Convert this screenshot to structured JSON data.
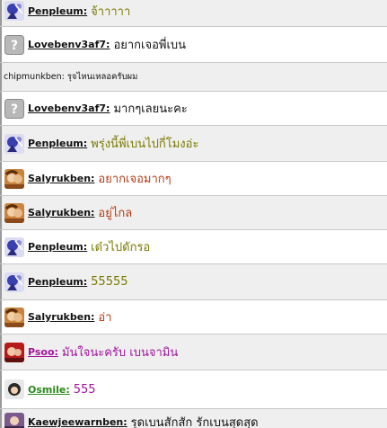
{
  "chat": {
    "messages": [
      {
        "kind": "user",
        "avatar": "penpleum-avatar",
        "name": "Penpleum:",
        "text": "จ้าาาาา",
        "name_color": "#111111",
        "text_color": "#7a7a00",
        "alt": true
      },
      {
        "kind": "user",
        "avatar": "guest-avatar",
        "name": "Lovebenv3af7:",
        "text": "อยากเจอพี่เบน",
        "name_color": "#111111",
        "text_color": "#111111",
        "alt": false
      },
      {
        "kind": "plain",
        "text": "chipmunkben: รุจไหนเหลอครับผม",
        "alt": true
      },
      {
        "kind": "user",
        "avatar": "guest-avatar",
        "name": "Lovebenv3af7:",
        "text": "มากๆเลยนะคะ",
        "name_color": "#111111",
        "text_color": "#111111",
        "alt": false
      },
      {
        "kind": "user",
        "avatar": "penpleum-avatar",
        "name": "Penpleum:",
        "text": "พรุ่งนี้พี่เบนไปกี่โมงอ่ะ",
        "name_color": "#111111",
        "text_color": "#7a7a00",
        "alt": true
      },
      {
        "kind": "user",
        "avatar": "salyrukben-avatar",
        "name": "Salyrukben:",
        "text": "อยากเจอมากๆ",
        "name_color": "#111111",
        "text_color": "#b43c14",
        "alt": false
      },
      {
        "kind": "user",
        "avatar": "salyrukben-avatar",
        "name": "Salyrukben:",
        "text": "อยู่ไกล",
        "name_color": "#111111",
        "text_color": "#b43c14",
        "alt": true
      },
      {
        "kind": "user",
        "avatar": "penpleum-avatar",
        "name": "Penpleum:",
        "text": "เด๋วไปดักรอ",
        "name_color": "#111111",
        "text_color": "#7a7a00",
        "alt": false
      },
      {
        "kind": "user",
        "avatar": "penpleum-avatar",
        "name": "Penpleum:",
        "text": "55555",
        "name_color": "#111111",
        "text_color": "#7a7a00",
        "alt": true
      },
      {
        "kind": "user",
        "avatar": "salyrukben-avatar",
        "name": "Salyrukben:",
        "text": "อ่า",
        "name_color": "#111111",
        "text_color": "#b43c14",
        "alt": false
      },
      {
        "kind": "user",
        "avatar": "psoo-avatar",
        "name": "Psoo:",
        "text": "มันใจนะครับ เบนจามิน",
        "name_color": "#a0149b",
        "text_color": "#a0149b",
        "alt": true
      },
      {
        "kind": "user",
        "avatar": "osmile-avatar",
        "name": "Osmile:",
        "text": "555",
        "name_color": "#2a8a1a",
        "text_color": "#a0149b",
        "alt": false
      },
      {
        "kind": "user",
        "avatar": "kaewjee-avatar",
        "name": "Kaewjeewarnben:",
        "text": "รุดเบนสักสัก รักเบนสุดสุด",
        "name_color": "#111111",
        "text_color": "#111111",
        "alt": true
      }
    ]
  }
}
